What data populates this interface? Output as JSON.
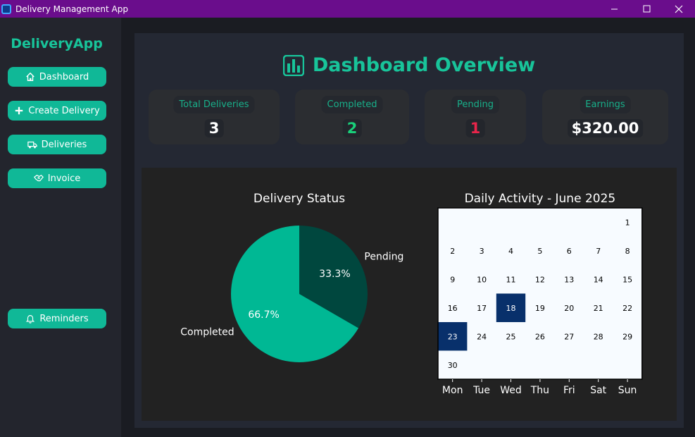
{
  "window": {
    "title": "Delivery Management App",
    "minimize": "—",
    "maximize": "☐",
    "close": "✕"
  },
  "sidebar": {
    "brand": "DeliveryApp",
    "items": [
      {
        "label": "Dashboard",
        "icon": "home-icon"
      },
      {
        "label": "Create Delivery",
        "icon": "plus-icon"
      },
      {
        "label": "Deliveries",
        "icon": "truck-icon"
      },
      {
        "label": "Invoice",
        "icon": "handshake-icon"
      },
      {
        "label": "Reminders",
        "icon": "bell-icon"
      }
    ]
  },
  "dashboard": {
    "title": "Dashboard Overview",
    "title_icon": "bar-chart-icon",
    "accent": "#18c49a",
    "stats": [
      {
        "label": "Total Deliveries",
        "value": "3",
        "color": "#ffffff"
      },
      {
        "label": "Completed",
        "value": "2",
        "color": "#19d07a"
      },
      {
        "label": "Pending",
        "value": "1",
        "color": "#e8254a"
      },
      {
        "label": "Earnings",
        "value": "$320.00",
        "color": "#ffffff"
      }
    ]
  },
  "chart_data": [
    {
      "type": "pie",
      "title": "Delivery Status",
      "labels": [
        "Pending",
        "Completed"
      ],
      "values": [
        1,
        2
      ],
      "percent_labels": [
        "33.3%",
        "66.7%"
      ],
      "colors": [
        "#00473e",
        "#00b894"
      ]
    },
    {
      "type": "heatmap",
      "title": "Daily Activity - June 2025",
      "weekday_labels": [
        "Mon",
        "Tue",
        "Wed",
        "Thu",
        "Fri",
        "Sat",
        "Sun"
      ],
      "first_weekday_index": 6,
      "days_in_month": 30,
      "activity": {
        "18": 1,
        "23": 1
      },
      "colors": {
        "empty": "#f7fbff",
        "active": "#08306b"
      }
    }
  ]
}
